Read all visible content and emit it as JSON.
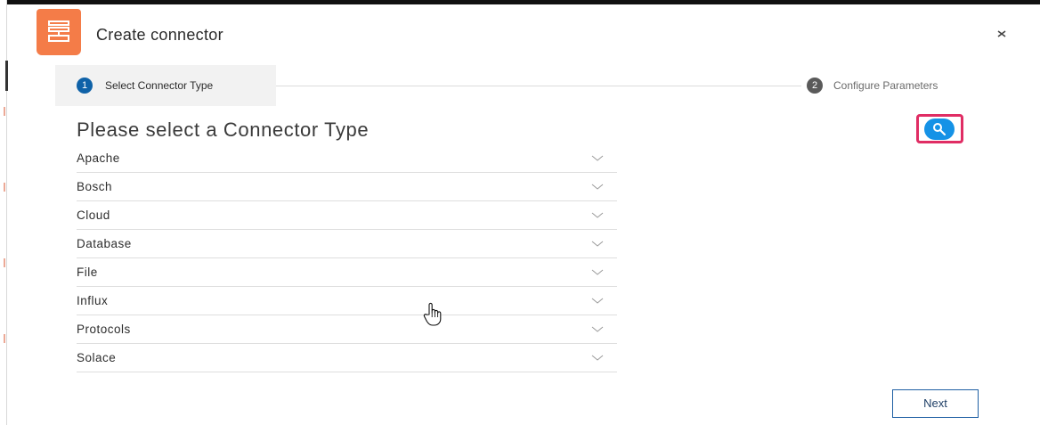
{
  "dialog": {
    "title": "Create connector",
    "close_icon": "close-icon",
    "app_icon": "connector-icon",
    "accent_color": "#f47c48"
  },
  "steps": [
    {
      "number": "1",
      "label": "Select Connector Type",
      "state": "active"
    },
    {
      "number": "2",
      "label": "Configure Parameters",
      "state": "inactive"
    }
  ],
  "main": {
    "heading": "Please select a Connector Type",
    "search_icon": "search-icon",
    "connector_types": [
      {
        "label": "Apache"
      },
      {
        "label": "Bosch"
      },
      {
        "label": "Cloud"
      },
      {
        "label": "Database"
      },
      {
        "label": "File"
      },
      {
        "label": "Influx"
      },
      {
        "label": "Protocols"
      },
      {
        "label": "Solace"
      }
    ]
  },
  "footer": {
    "next_label": "Next"
  },
  "colors": {
    "primary": "#0f62a8",
    "search_button": "#1592e6",
    "highlight": "#e02d64"
  }
}
